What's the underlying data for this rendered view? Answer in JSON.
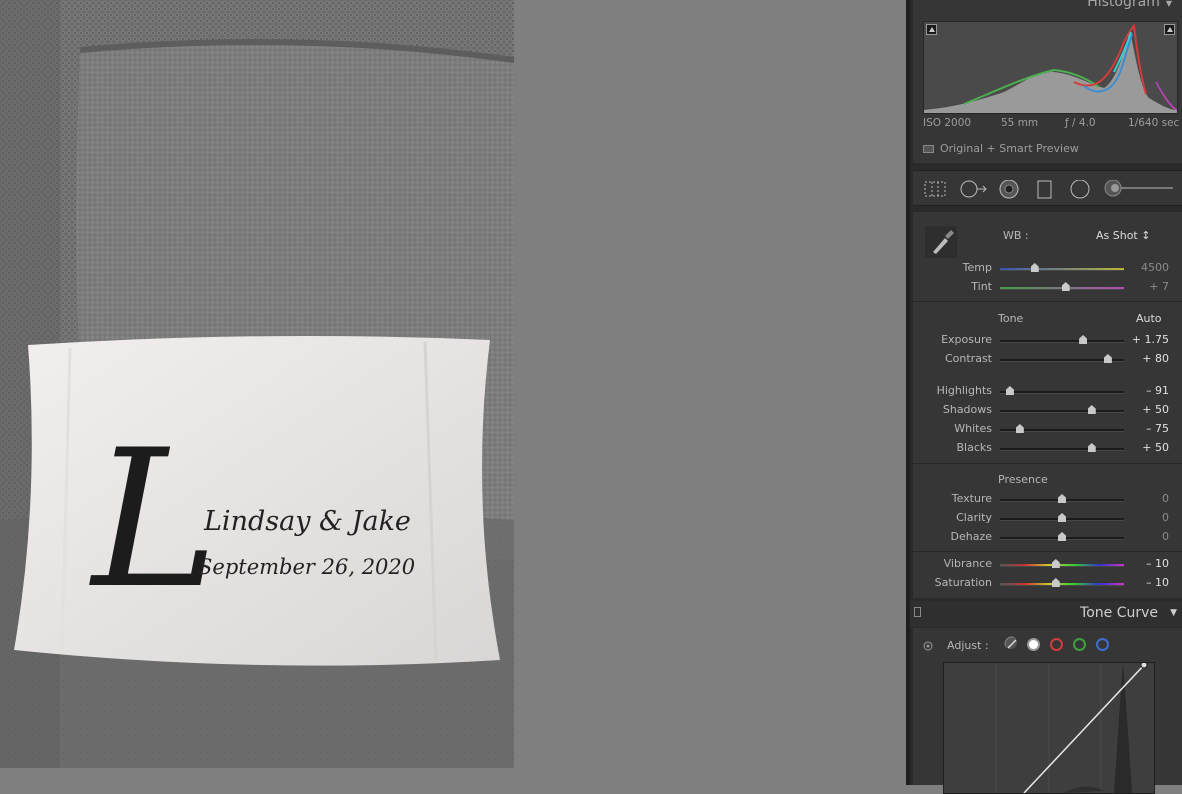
{
  "photo": {
    "monogram": "L",
    "line1": "Lindsay & Jake",
    "line2": "September 26, 2020"
  },
  "histogram": {
    "title": "Histogram",
    "iso": "ISO 2000",
    "focal": "55 mm",
    "aperture": "ƒ / 4.0",
    "shutter": "1/640 sec",
    "preview": "Original + Smart Preview"
  },
  "tools": [
    "crop-overlay-tool",
    "spot-removal-tool",
    "red-eye-tool",
    "graduated-filter-tool",
    "radial-filter-tool",
    "adjustment-brush-tool"
  ],
  "basic": {
    "wb_label": "WB :",
    "wb_value": "As Shot ↕",
    "temp": {
      "label": "Temp",
      "value": "4500",
      "pos": 0.28
    },
    "tint": {
      "label": "Tint",
      "value": "+ 7",
      "pos": 0.53
    },
    "tone_label": "Tone",
    "auto_label": "Auto",
    "exposure": {
      "label": "Exposure",
      "value": "+ 1.75",
      "pos": 0.67
    },
    "contrast": {
      "label": "Contrast",
      "value": "+ 80",
      "pos": 0.87
    },
    "highlights": {
      "label": "Highlights",
      "value": "– 91",
      "pos": 0.08
    },
    "shadows": {
      "label": "Shadows",
      "value": "+ 50",
      "pos": 0.74
    },
    "whites": {
      "label": "Whites",
      "value": "– 75",
      "pos": 0.16
    },
    "blacks": {
      "label": "Blacks",
      "value": "+ 50",
      "pos": 0.74
    },
    "presence_label": "Presence",
    "texture": {
      "label": "Texture",
      "value": "0",
      "pos": 0.5
    },
    "clarity": {
      "label": "Clarity",
      "value": "0",
      "pos": 0.5
    },
    "dehaze": {
      "label": "Dehaze",
      "value": "0",
      "pos": 0.5
    },
    "vibrance": {
      "label": "Vibrance",
      "value": "– 10",
      "pos": 0.45
    },
    "saturation": {
      "label": "Saturation",
      "value": "– 10",
      "pos": 0.45
    }
  },
  "tone_curve": {
    "title": "Tone Curve",
    "adjust_label": "Adjust :"
  },
  "colors": {
    "panel_bg": "#363636",
    "canvas_bg": "#7f7f7f",
    "red_channel": "#d23c3c",
    "green_channel": "#3ca03c",
    "blue_channel": "#3c6ed2"
  }
}
